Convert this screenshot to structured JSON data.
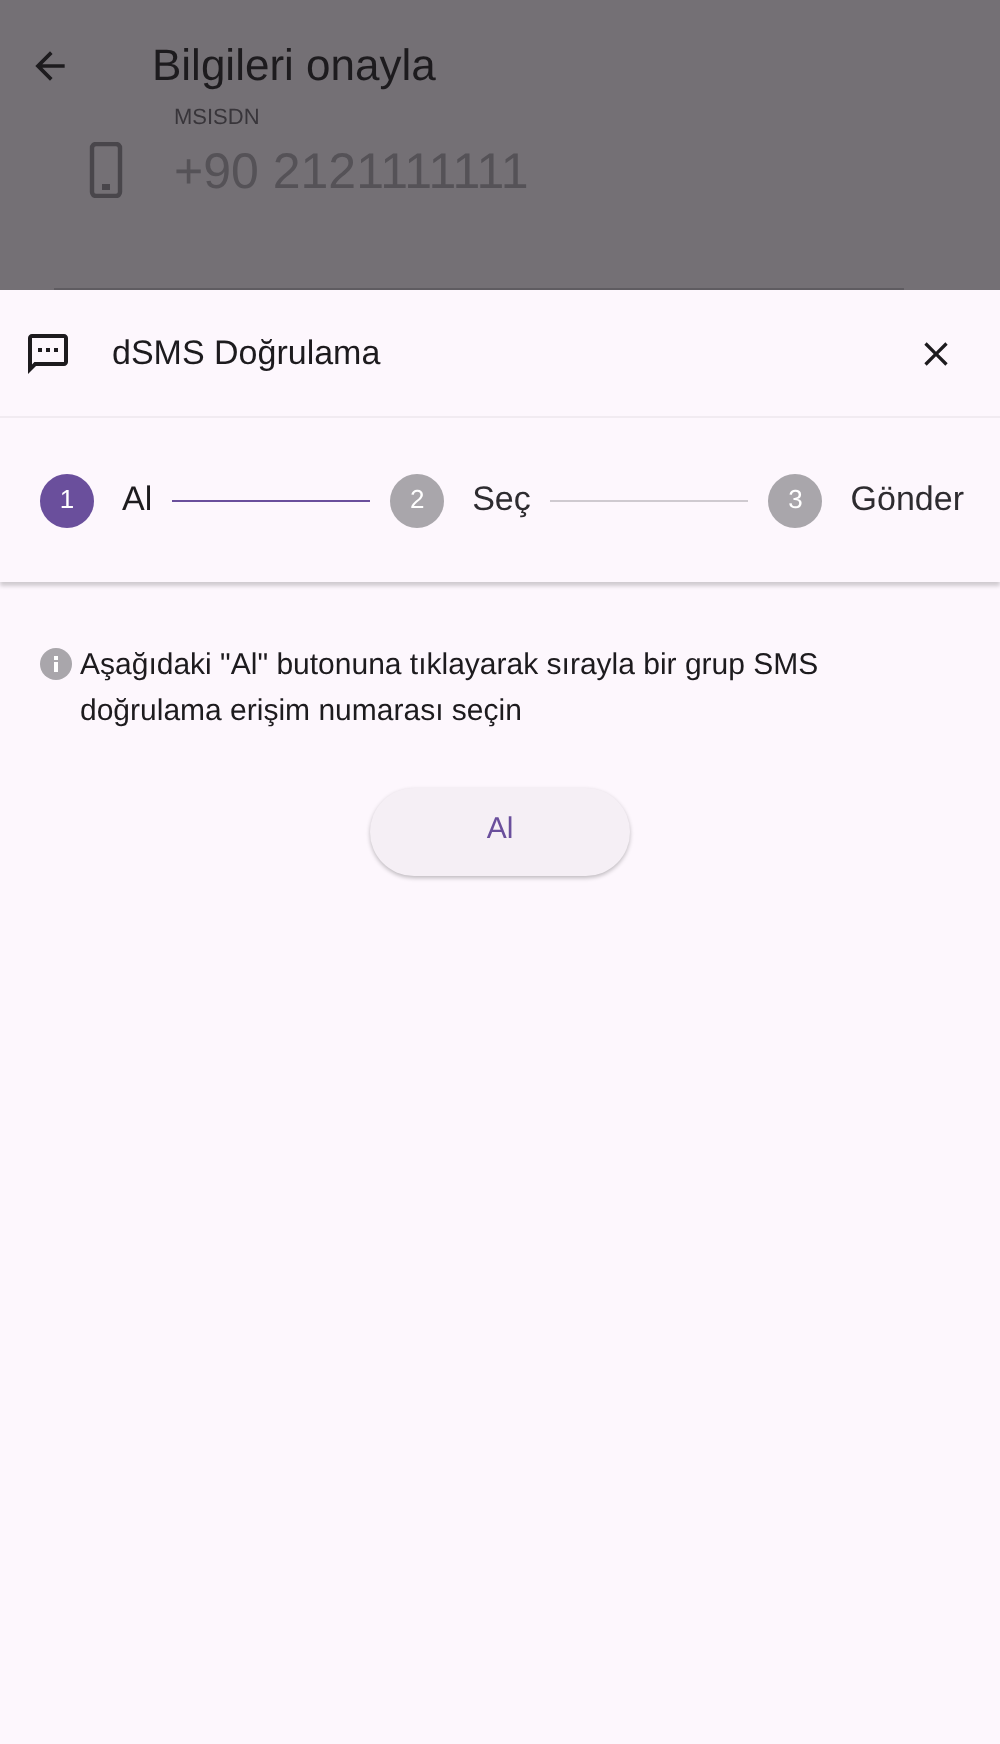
{
  "background": {
    "title": "Bilgileri onayla",
    "field": {
      "label": "MSISDN",
      "value": "+90 2121111111"
    }
  },
  "sheet": {
    "title": "dSMS Doğrulama",
    "steps": [
      {
        "number": "1",
        "label": "Al",
        "selected": true
      },
      {
        "number": "2",
        "label": "Seç",
        "selected": false
      },
      {
        "number": "3",
        "label": "Gönder",
        "selected": false
      }
    ],
    "info": "Aşağıdaki \"Al\" butonuna tıklayarak sırayla bir grup SMS doğrulama erişim numarası seçin",
    "button": "Al"
  }
}
